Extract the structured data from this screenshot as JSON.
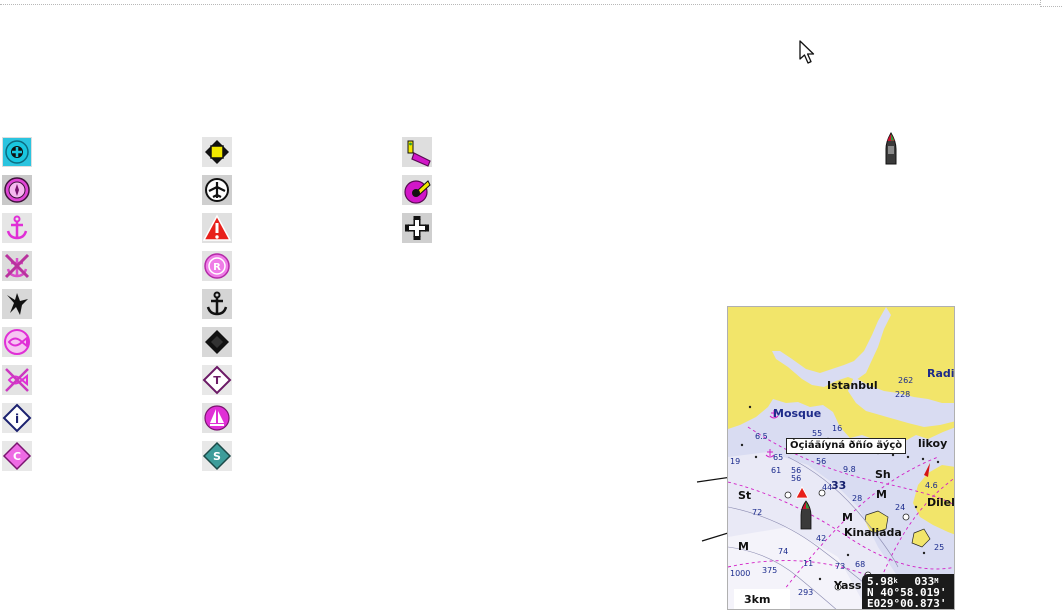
{
  "map": {
    "place_labels": [
      "Istanbul",
      "Radi",
      "Mosque",
      "likoy",
      "Sh",
      "St",
      "M",
      "M",
      "Kinaliada",
      "Dilel",
      "M",
      "Yass"
    ],
    "depths": [
      "262",
      "228",
      "16",
      "55",
      "56",
      "65",
      "61",
      "56",
      "19",
      "6.5",
      "9.8",
      "56",
      "33",
      "28",
      "44",
      "24",
      "72",
      "42",
      "74",
      "11",
      "73",
      "68",
      "25",
      "1000",
      "375",
      "293",
      "4.6"
    ],
    "tooltip": "Òçiáäíyná ðñío äýçò",
    "speed": "5.98",
    "speed_unit": "k",
    "heading": "033",
    "heading_unit": "M",
    "latitude": "N  40°58.019'",
    "longitude": "E029°00.873'",
    "scale": "3km"
  },
  "colors": {
    "land": "#f2e56a",
    "water": "#d9dcf2",
    "deep_water": "#ffffff",
    "track_pink": "#d21fc6",
    "icon_magenta": "#d016c6",
    "icon_cyan": "#19c7e0"
  },
  "icons": {
    "col1": [
      "cross-marina-icon",
      "compass-circle-icon",
      "anchor-pink-icon",
      "no-anchor-icon",
      "wreck-icon",
      "fish-icon",
      "no-fish-icon",
      "info-diamond-icon",
      "c-diamond-icon"
    ],
    "col2": [
      "yellow-square-icon",
      "airport-icon",
      "danger-triangle-icon",
      "r-circle-icon",
      "anchor-black-icon",
      "black-diamond-icon",
      "t-diamond-icon",
      "sail-icon",
      "s-diamond-icon"
    ],
    "col3": [
      "boat-launch-icon",
      "boat-ramp-icon",
      "white-cross-icon"
    ]
  }
}
